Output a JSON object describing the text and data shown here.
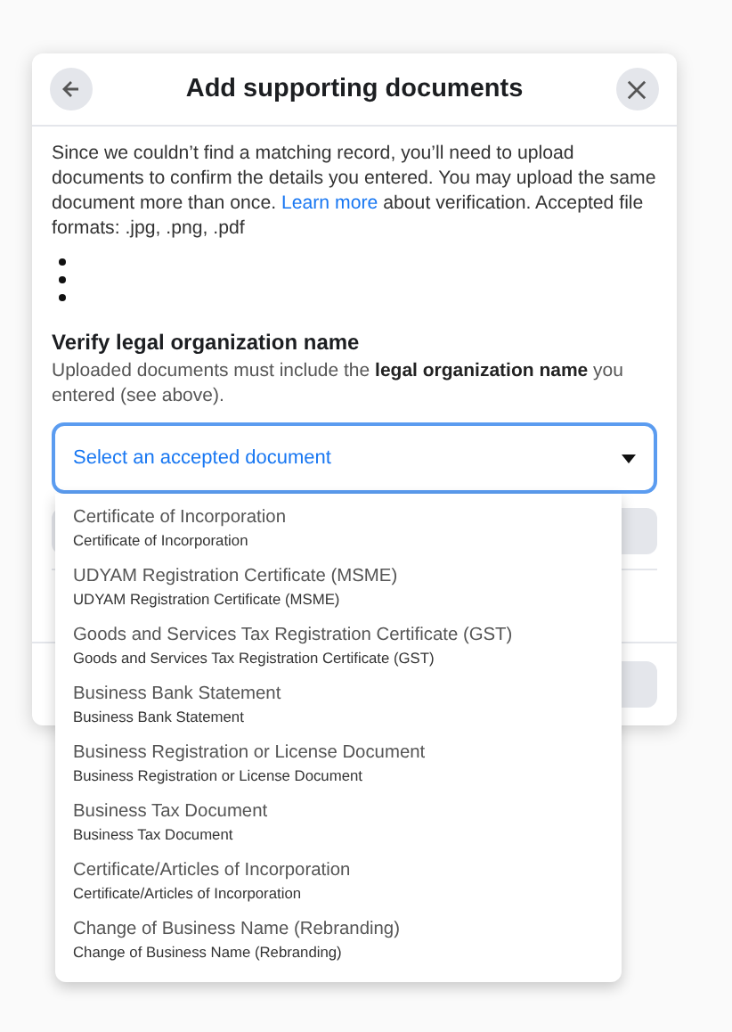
{
  "dialog": {
    "title": "Add supporting documents",
    "intro": {
      "before": "Since we couldn’t find a matching record, you’ll need to upload documents to confirm the details you entered. You may upload the same document more than once.",
      "link": "Learn more",
      "after": "about verification. Accepted file formats: .jpg, .png, .pdf"
    },
    "section": {
      "heading": "Verify legal organization name",
      "description": "Uploaded documents must include the **legal organization name** you entered (see above)."
    },
    "select": {
      "placeholder": "Select an accepted document",
      "expanded": true,
      "options": [
        {
          "title": "Certificate of Incorporation",
          "subtitle": "Certificate of Incorporation"
        },
        {
          "title": "UDYAM Registration Certificate (MSME)",
          "subtitle": "UDYAM Registration Certificate (MSME)"
        },
        {
          "title": "Goods and Services Tax Registration Certificate (GST)",
          "subtitle": "Goods and Services Tax Registration Certificate (GST)"
        },
        {
          "title": "Business Bank Statement",
          "subtitle": "Business Bank Statement"
        },
        {
          "title": "Business Registration or License Document",
          "subtitle": "Business Registration or License Document"
        },
        {
          "title": "Business Tax Document",
          "subtitle": "Business Tax Document"
        },
        {
          "title": "Certificate/Articles of Incorporation",
          "subtitle": "Certificate/Articles of Incorporation"
        },
        {
          "title": "Change of Business Name (Rebranding)",
          "subtitle": "Change of Business Name (Rebranding)"
        }
      ]
    }
  }
}
